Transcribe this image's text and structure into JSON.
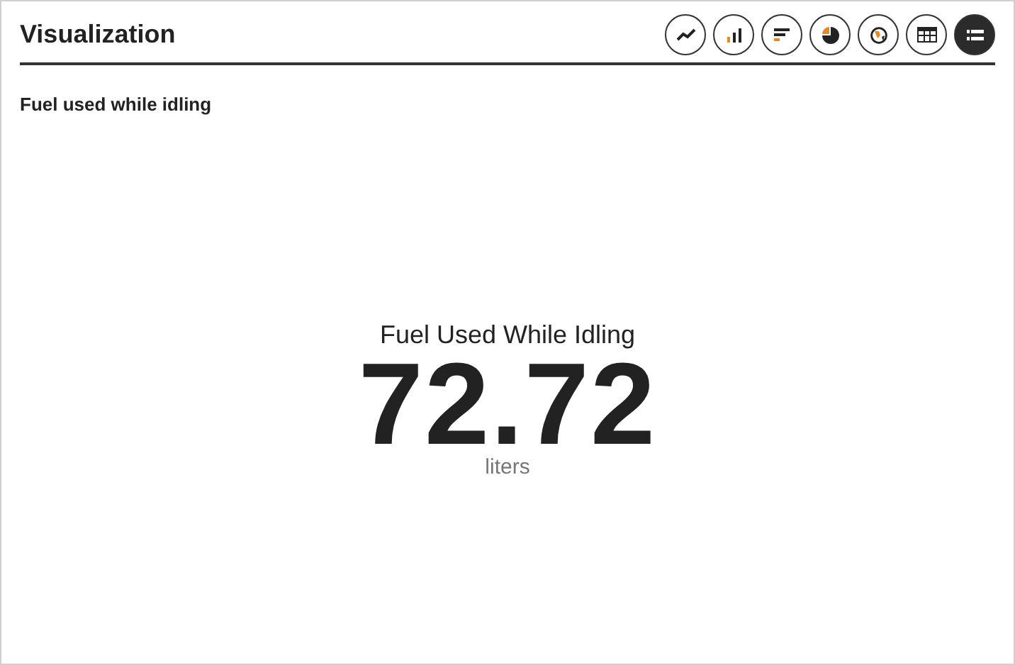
{
  "header": {
    "title": "Visualization"
  },
  "chart_types": [
    {
      "kind": "line",
      "selected": false
    },
    {
      "kind": "bar",
      "selected": false
    },
    {
      "kind": "hbar",
      "selected": false
    },
    {
      "kind": "pie",
      "selected": false
    },
    {
      "kind": "globe",
      "selected": false
    },
    {
      "kind": "table",
      "selected": false
    },
    {
      "kind": "list",
      "selected": true
    }
  ],
  "panel": {
    "title": "Fuel used while idling"
  },
  "metric": {
    "label": "Fuel Used While Idling",
    "value": "72.72",
    "unit": "liters"
  }
}
